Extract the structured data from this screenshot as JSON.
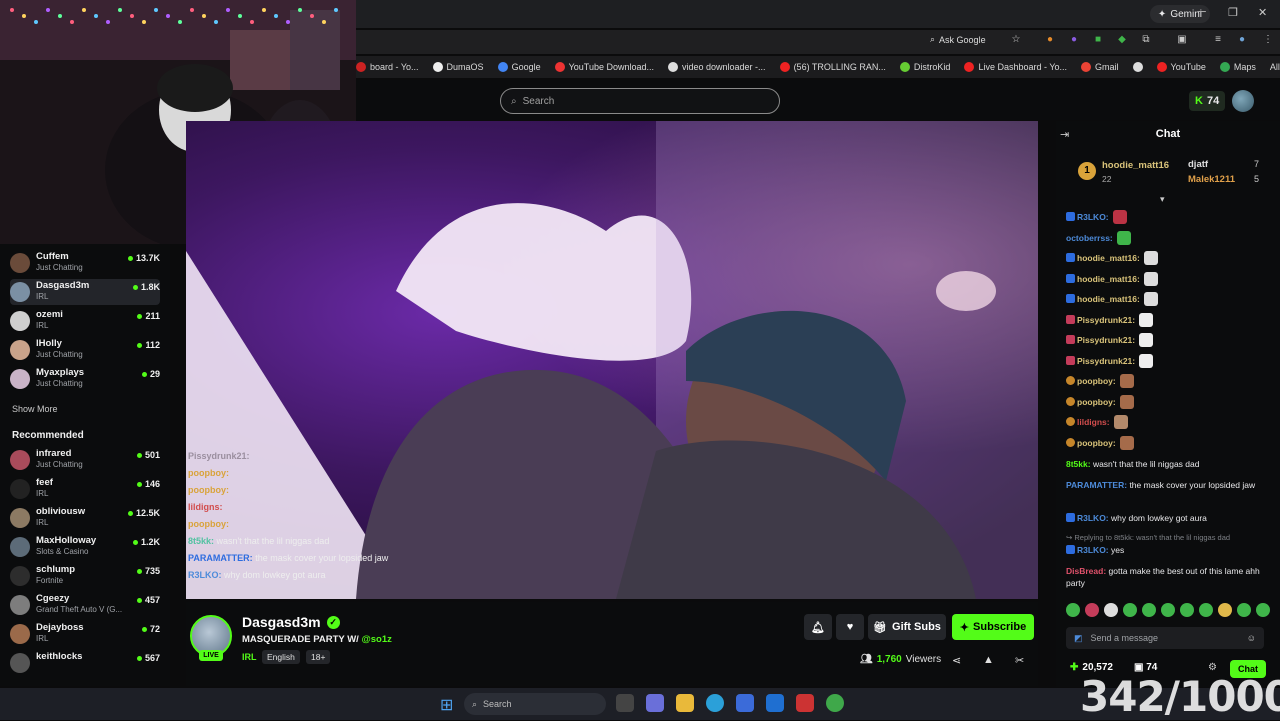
{
  "browser": {
    "gemini_label": "Gemini",
    "ask_google": "Ask Google",
    "bookmarks": [
      {
        "label": "board - Yo...",
        "color": "#c22"
      },
      {
        "label": "DumaOS",
        "color": "#eee"
      },
      {
        "label": "Google",
        "color": "#4285f4"
      },
      {
        "label": "YouTube Download...",
        "color": "#e33"
      },
      {
        "label": "video downloader -...",
        "color": "#ddd"
      },
      {
        "label": "(56) TROLLING RAN...",
        "color": "#e22"
      },
      {
        "label": "DistroKid",
        "color": "#6c3"
      },
      {
        "label": "Live Dashboard - Yo...",
        "color": "#e22"
      },
      {
        "label": "Gmail",
        "color": "#ea4335"
      },
      {
        "label": "",
        "color": "#ddd"
      },
      {
        "label": "YouTube",
        "color": "#e22"
      },
      {
        "label": "Maps",
        "color": "#34a853"
      }
    ],
    "all_bookmarks": "All Bookmarks"
  },
  "header": {
    "search_placeholder": "Search",
    "kick_points": "74"
  },
  "sidebar": {
    "following": [
      {
        "name": "Cuffem",
        "category": "Just Chatting",
        "viewers": "13.7K",
        "avatar": "#6a4b3a"
      },
      {
        "name": "Dasgasd3m",
        "category": "IRL",
        "viewers": "1.8K",
        "avatar": "#7b90a4",
        "active": true
      },
      {
        "name": "ozemi",
        "category": "IRL",
        "viewers": "211",
        "avatar": "#cfcfcf"
      },
      {
        "name": "lHolly",
        "category": "Just Chatting",
        "viewers": "112",
        "avatar": "#c9a38a"
      },
      {
        "name": "Myaxplays",
        "category": "Just Chatting",
        "viewers": "29",
        "avatar": "#c9b3c7"
      }
    ],
    "show_more": "Show More",
    "recommended_title": "Recommended",
    "recommended": [
      {
        "name": "infrared",
        "category": "Just Chatting",
        "viewers": "501",
        "avatar": "#a94b5b"
      },
      {
        "name": "feef",
        "category": "IRL",
        "viewers": "146",
        "avatar": "#222"
      },
      {
        "name": "obliviousw",
        "category": "IRL",
        "viewers": "12.5K",
        "avatar": "#8c7a63"
      },
      {
        "name": "MaxHolloway",
        "category": "Slots & Casino",
        "viewers": "1.2K",
        "avatar": "#5c6b78"
      },
      {
        "name": "schlump",
        "category": "Fortnite",
        "viewers": "735",
        "avatar": "#2d2d2d"
      },
      {
        "name": "Cgeezy",
        "category": "Grand Theft Auto V (G...",
        "viewers": "457",
        "avatar": "#7d7d7d"
      },
      {
        "name": "Dejayboss",
        "category": "IRL",
        "viewers": "72",
        "avatar": "#9b6a4a"
      },
      {
        "name": "keithlocks",
        "category": "",
        "viewers": "567",
        "avatar": "#555"
      }
    ]
  },
  "video_overlay": [
    {
      "user": "Pissydrunk21:",
      "text": "",
      "color": "#9b8f9f"
    },
    {
      "user": "poopboy:",
      "text": "",
      "color": "#d9a33a"
    },
    {
      "user": "poopboy:",
      "text": "",
      "color": "#d9a33a"
    },
    {
      "user": "lildigns:",
      "text": "",
      "color": "#d24d4d"
    },
    {
      "user": "poopboy:",
      "text": "",
      "color": "#d9a33a"
    },
    {
      "user": "8t5kk:",
      "text": "wasn't that the lil niggas dad",
      "color": "#53c2a2"
    },
    {
      "user": "PARAMATTER:",
      "text": "the mask cover your lopsided jaw",
      "color": "#2d6cdf"
    },
    {
      "user": "R3LKO:",
      "text": "why dom lowkey got aura",
      "color": "#4d8bd9"
    }
  ],
  "stream": {
    "streamer": "Dasgasd3m",
    "live": "LIVE",
    "title": "MASQUERADE PARTY W/ ",
    "title_mention": "@so1z",
    "category": "IRL",
    "tags": [
      "English",
      "18+"
    ],
    "gift_subs": "Gift Subs",
    "subscribe": "Subscribe",
    "viewers": "1,760",
    "viewers_label": "Viewers"
  },
  "chat": {
    "title": "Chat",
    "leaderboard": [
      {
        "rank": "1",
        "name": "hoodie_matt16",
        "count": "22"
      },
      {
        "name": "djatf",
        "count": "7"
      },
      {
        "name": "Malek1211",
        "count": "5"
      }
    ],
    "messages": [
      {
        "user": "R3LKO:",
        "text": "",
        "color": "#4d8bd9",
        "badge": "b",
        "emote": "#b34"
      },
      {
        "user": "octoberrss:",
        "text": "",
        "color": "#4d8bd9",
        "badge": "",
        "emote": "#3fb54a"
      },
      {
        "user": "hoodie_matt16:",
        "text": "",
        "color": "#d9c37a",
        "badge": "b",
        "emote": "#ddd"
      },
      {
        "user": "hoodie_matt16:",
        "text": "",
        "color": "#d9c37a",
        "badge": "b",
        "emote": "#ddd"
      },
      {
        "user": "hoodie_matt16:",
        "text": "",
        "color": "#d9c37a",
        "badge": "b",
        "emote": "#ddd"
      },
      {
        "user": "Pissydrunk21:",
        "text": "",
        "color": "#d9c37a",
        "badge": "r",
        "emote": "#eee"
      },
      {
        "user": "Pissydrunk21:",
        "text": "",
        "color": "#d9c37a",
        "badge": "r",
        "emote": "#eee"
      },
      {
        "user": "Pissydrunk21:",
        "text": "",
        "color": "#d9c37a",
        "badge": "r",
        "emote": "#eee"
      },
      {
        "user": "poopboy:",
        "text": "",
        "color": "#d9c37a",
        "badge": "g",
        "emote": "#a56b4a"
      },
      {
        "user": "poopboy:",
        "text": "",
        "color": "#d9c37a",
        "badge": "g",
        "emote": "#a56b4a"
      },
      {
        "user": "lildigns:",
        "text": "",
        "color": "#d24d4d",
        "badge": "g",
        "emote": "#b38a6b"
      },
      {
        "user": "poopboy:",
        "text": "",
        "color": "#d9c37a",
        "badge": "g",
        "emote": "#a56b4a"
      },
      {
        "user": "8t5kk:",
        "text": " wasn't that the lil niggas dad",
        "color": "#53fc18",
        "badge": "",
        "emote": ""
      },
      {
        "user": "PARAMATTER:",
        "text": " the mask cover your lopsided jaw",
        "color": "#4d8bd9",
        "badge": "",
        "emote": ""
      },
      {
        "user": "R3LKO:",
        "text": " why dom lowkey got aura",
        "color": "#4d8bd9",
        "badge": "b",
        "emote": ""
      },
      {
        "user": "↪ Replying to 8t5kk: wasn't that the lil niggas dad",
        "text": "",
        "color": "#7d8085",
        "badge": "",
        "emote": ""
      },
      {
        "user": "R3LKO:",
        "text": " yes",
        "color": "#4d8bd9",
        "badge": "b",
        "emote": ""
      },
      {
        "user": "DisBread:",
        "text": " gotta make the best out of this lame ahh party",
        "color": "#e0526b",
        "badge": "",
        "emote": ""
      }
    ],
    "send_placeholder": "Send a message",
    "points": "20,572",
    "subs": "74",
    "chat_button": "Chat"
  },
  "counter": "342/1000",
  "taskbar": {
    "search_placeholder": "Search"
  },
  "colors": {
    "accent": "#53fc18",
    "bg": "#0b0c0d"
  }
}
